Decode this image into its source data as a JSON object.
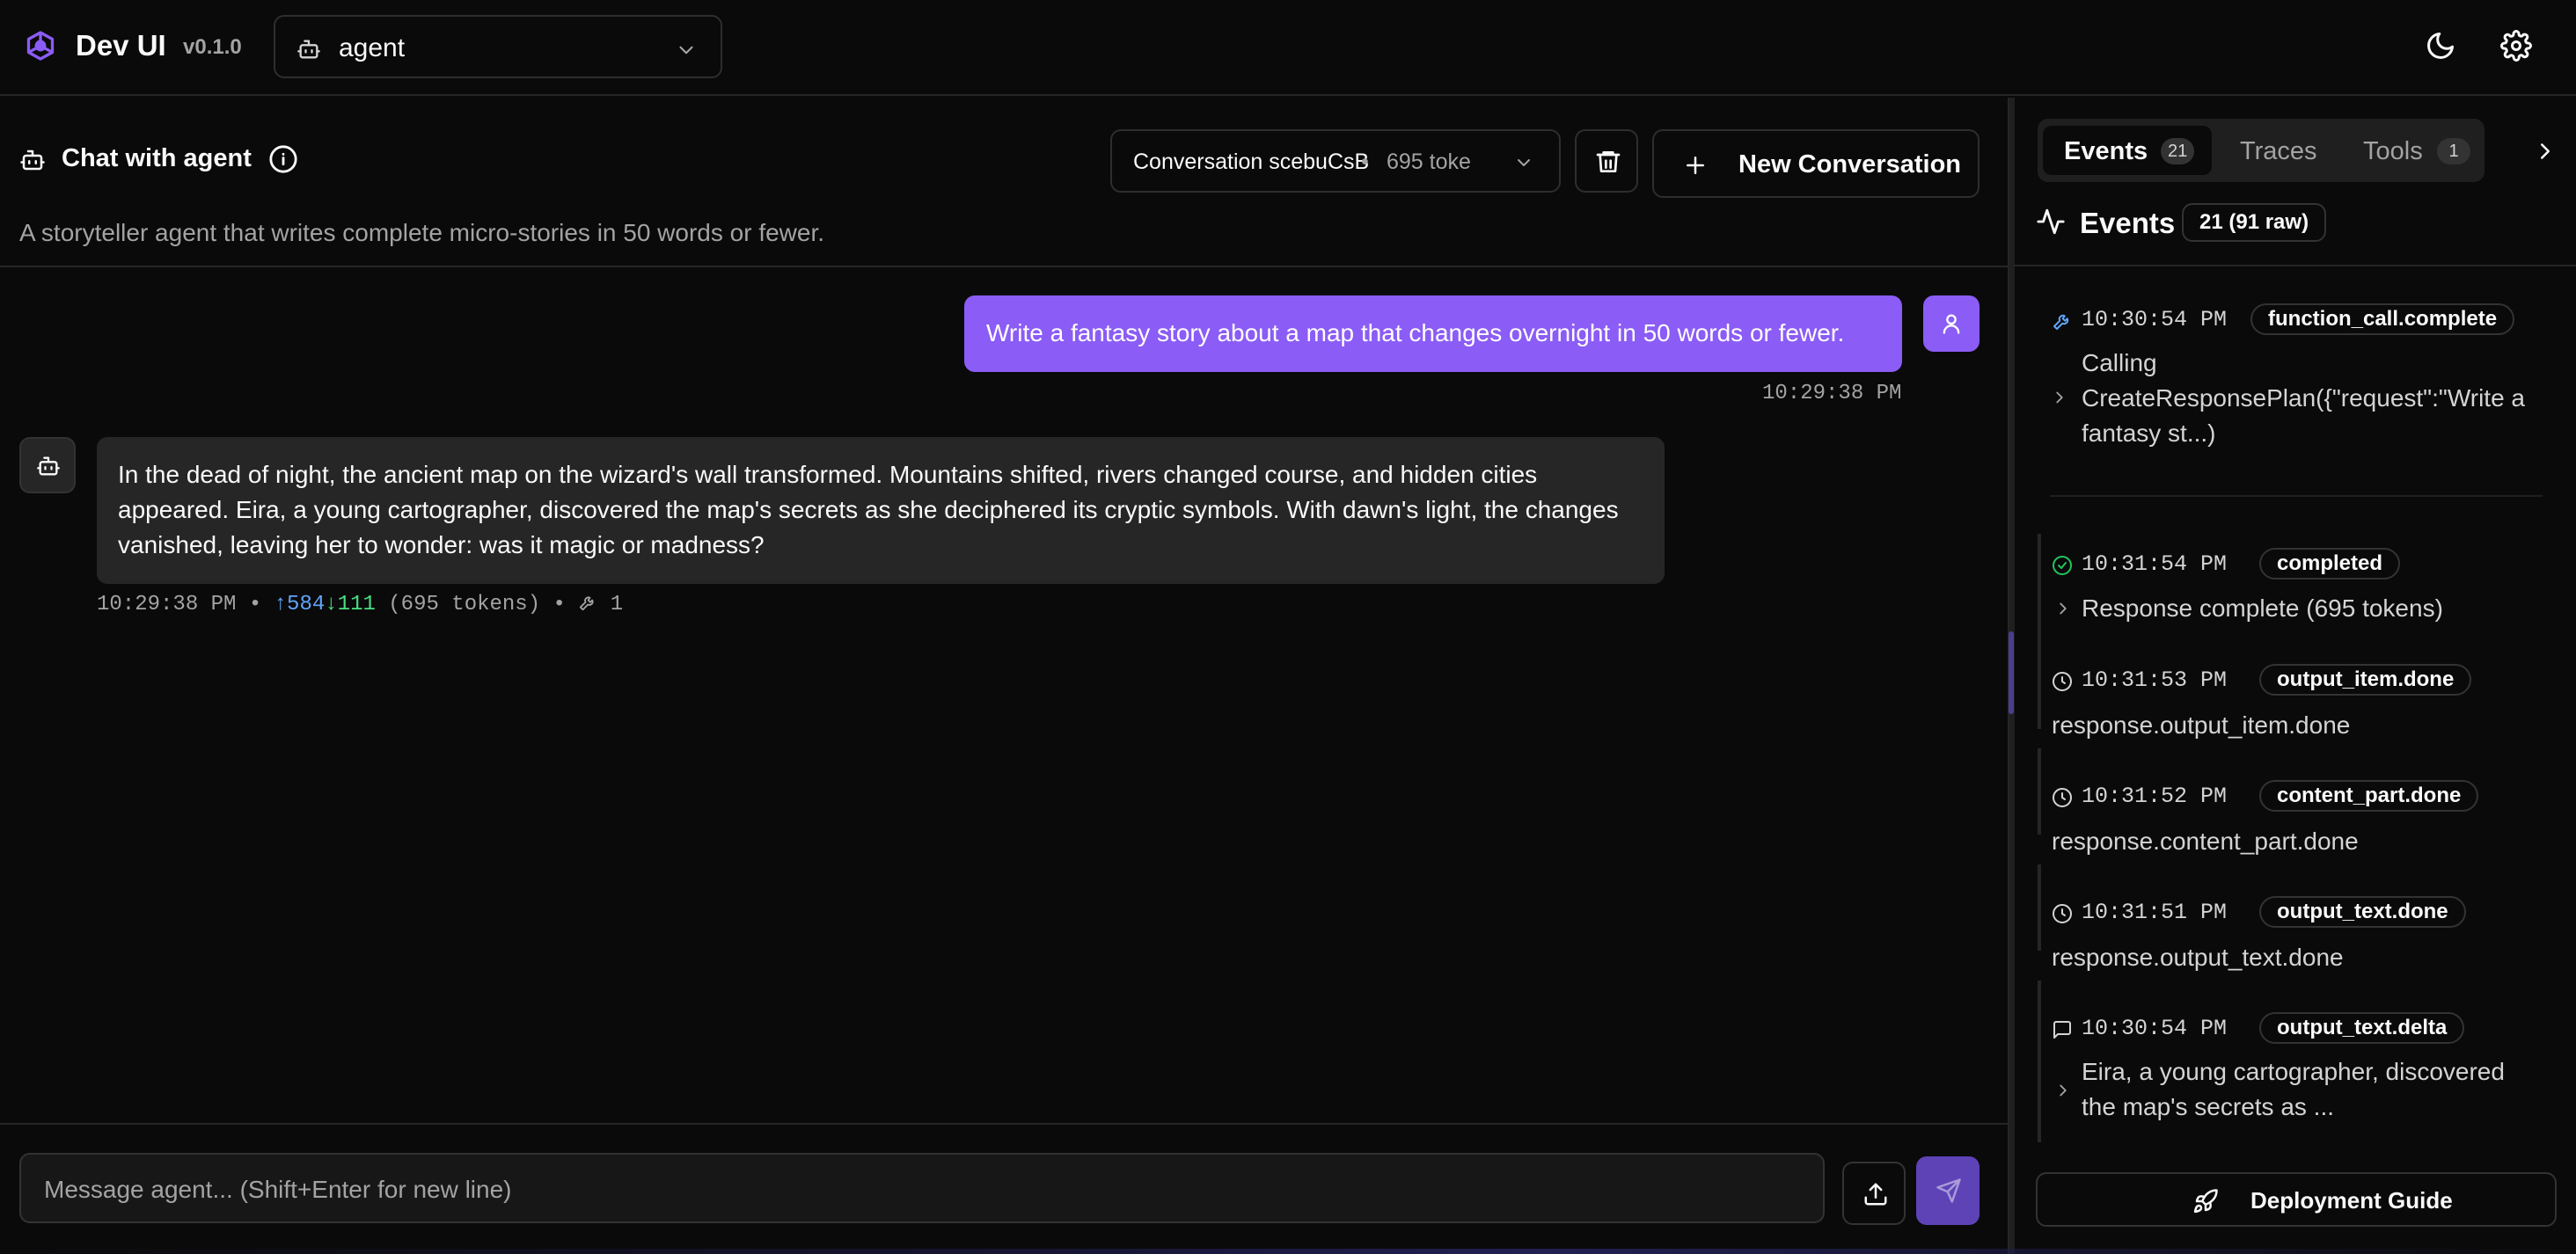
{
  "header": {
    "brand": "Dev UI",
    "version": "v0.1.0",
    "agent_select": "agent"
  },
  "chat": {
    "title": "Chat with agent",
    "subtitle": "A storyteller agent that writes complete micro-stories in 50 words or fewer.",
    "conversation": {
      "name": "Conversation scebuCsB",
      "separator": "•",
      "tokens": "695 toke"
    },
    "new_conversation_label": "New Conversation",
    "user_message": {
      "text": "Write a fantasy story about a map that changes overnight in 50 words or fewer.",
      "time": "10:29:38 PM"
    },
    "bot_message": {
      "text": "In the dead of night, the ancient map on the wizard's wall transformed. Mountains shifted, rivers changed course, and hidden cities appeared. Eira, a young cartographer, discovered the map's secrets as she deciphered its cryptic symbols. With dawn's light, the changes vanished, leaving her to wonder: was it magic or madness?",
      "time": "10:29:38 PM",
      "sep1": "•",
      "up": "↑584",
      "down": "↓111",
      "tokens": "(695 tokens)",
      "sep2": "•",
      "tool_calls": "1"
    },
    "input_placeholder": "Message agent... (Shift+Enter for new line)"
  },
  "panel": {
    "tabs": [
      {
        "label": "Events",
        "badge": "21"
      },
      {
        "label": "Traces",
        "badge": ""
      },
      {
        "label": "Tools",
        "badge": "1"
      }
    ],
    "events_title": "Events",
    "events_count": "21 (91 raw)",
    "events": [
      {
        "time": "10:30:54 PM",
        "tag": "function_call.complete",
        "icon": "wrench-icon",
        "line1": "Calling",
        "line2": "CreateResponsePlan({\"request\":\"Write a",
        "line3": "fantasy st...)"
      },
      {
        "time": "10:31:54 PM",
        "tag": "completed",
        "icon": "check-circle-icon",
        "body": "Response complete (695 tokens)"
      },
      {
        "time": "10:31:53 PM",
        "tag": "output_item.done",
        "icon": "clock-icon",
        "desc": "response.output_item.done"
      },
      {
        "time": "10:31:52 PM",
        "tag": "content_part.done",
        "icon": "clock-icon",
        "desc": "response.content_part.done"
      },
      {
        "time": "10:31:51 PM",
        "tag": "output_text.done",
        "icon": "clock-icon",
        "desc": "response.output_text.done"
      },
      {
        "time": "10:30:54 PM",
        "tag": "output_text.delta",
        "icon": "message-icon",
        "line1": "Eira, a young cartographer, discovered",
        "line2": "the map's secrets as ..."
      }
    ],
    "deployment_guide": "Deployment Guide"
  },
  "colors": {
    "accent": "#8b5cf6",
    "background": "#0a0a0a",
    "bubble_bot": "#262626",
    "up_tokens": "#60a5fa",
    "down_tokens": "#4ade80"
  }
}
